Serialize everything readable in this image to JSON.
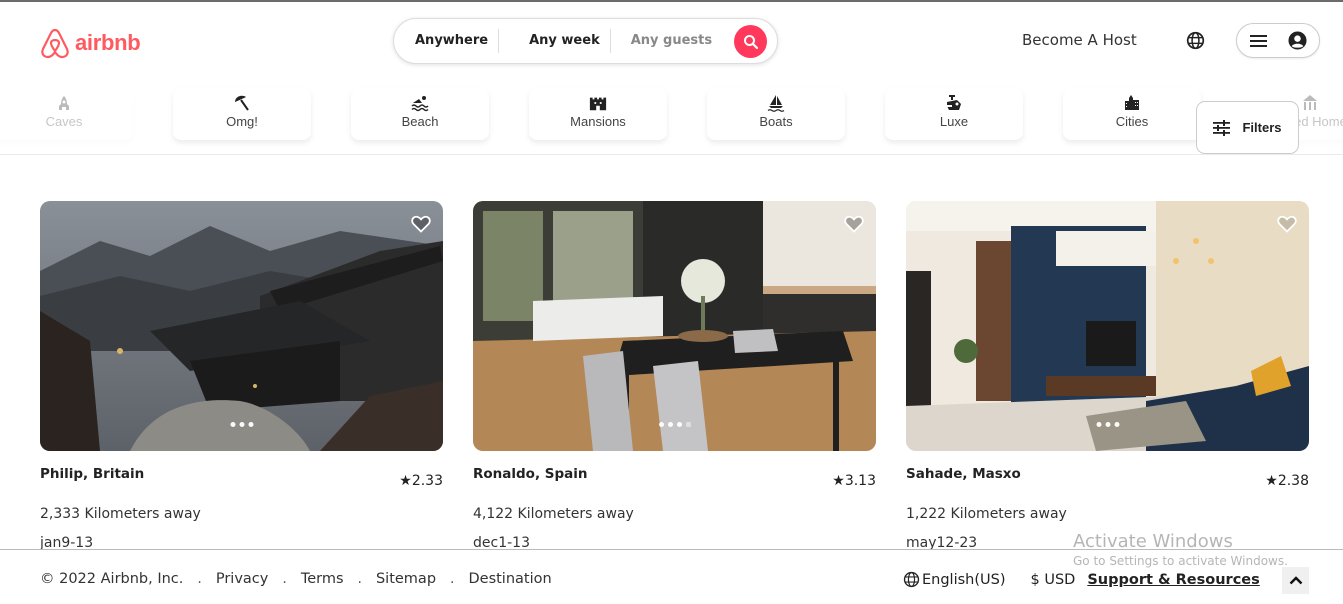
{
  "header": {
    "logo_text": "airbnb",
    "search": {
      "location": "Anywhere",
      "dates": "Any week",
      "guests": "Any guests"
    },
    "become_host": "Become A Host"
  },
  "categories": [
    {
      "label": "Caves",
      "icon": "caves-icon",
      "faded": true
    },
    {
      "label": "Omg!",
      "icon": "umbrella-icon"
    },
    {
      "label": "Beach",
      "icon": "swimmer-icon"
    },
    {
      "label": "Mansions",
      "icon": "castle-icon"
    },
    {
      "label": "Boats",
      "icon": "sailboat-icon"
    },
    {
      "label": "Luxe",
      "icon": "luxe-icon"
    },
    {
      "label": "Cities",
      "icon": "city-icon"
    },
    {
      "label": "Shared Homes",
      "icon": "shared-homes-icon",
      "faded": true
    }
  ],
  "filters_label": "Filters",
  "listings": [
    {
      "title": "Philip, Britain",
      "rating": "★2.33",
      "distance": "2,333 Kilometers away",
      "dates": "jan9-13"
    },
    {
      "title": "Ronaldo, Spain",
      "rating": "★3.13",
      "distance": "4,122 Kilometers away",
      "dates": "dec1-13"
    },
    {
      "title": "Sahade, Masxo",
      "rating": "★2.38",
      "distance": "1,222 Kilometers away",
      "dates": "may12-23"
    }
  ],
  "footer": {
    "copyright": "© 2022 Airbnb, Inc.",
    "links": [
      "Privacy",
      "Terms",
      "Sitemap",
      "Destination"
    ],
    "separator": ".",
    "language": "English(US)",
    "currency": "$ USD",
    "support": "Support & Resources"
  },
  "watermark": {
    "line1": "Activate Windows",
    "line2": "Go to Settings to activate Windows."
  },
  "colors": {
    "brand": "#ff5a5f",
    "search_button": "#ff385c"
  }
}
